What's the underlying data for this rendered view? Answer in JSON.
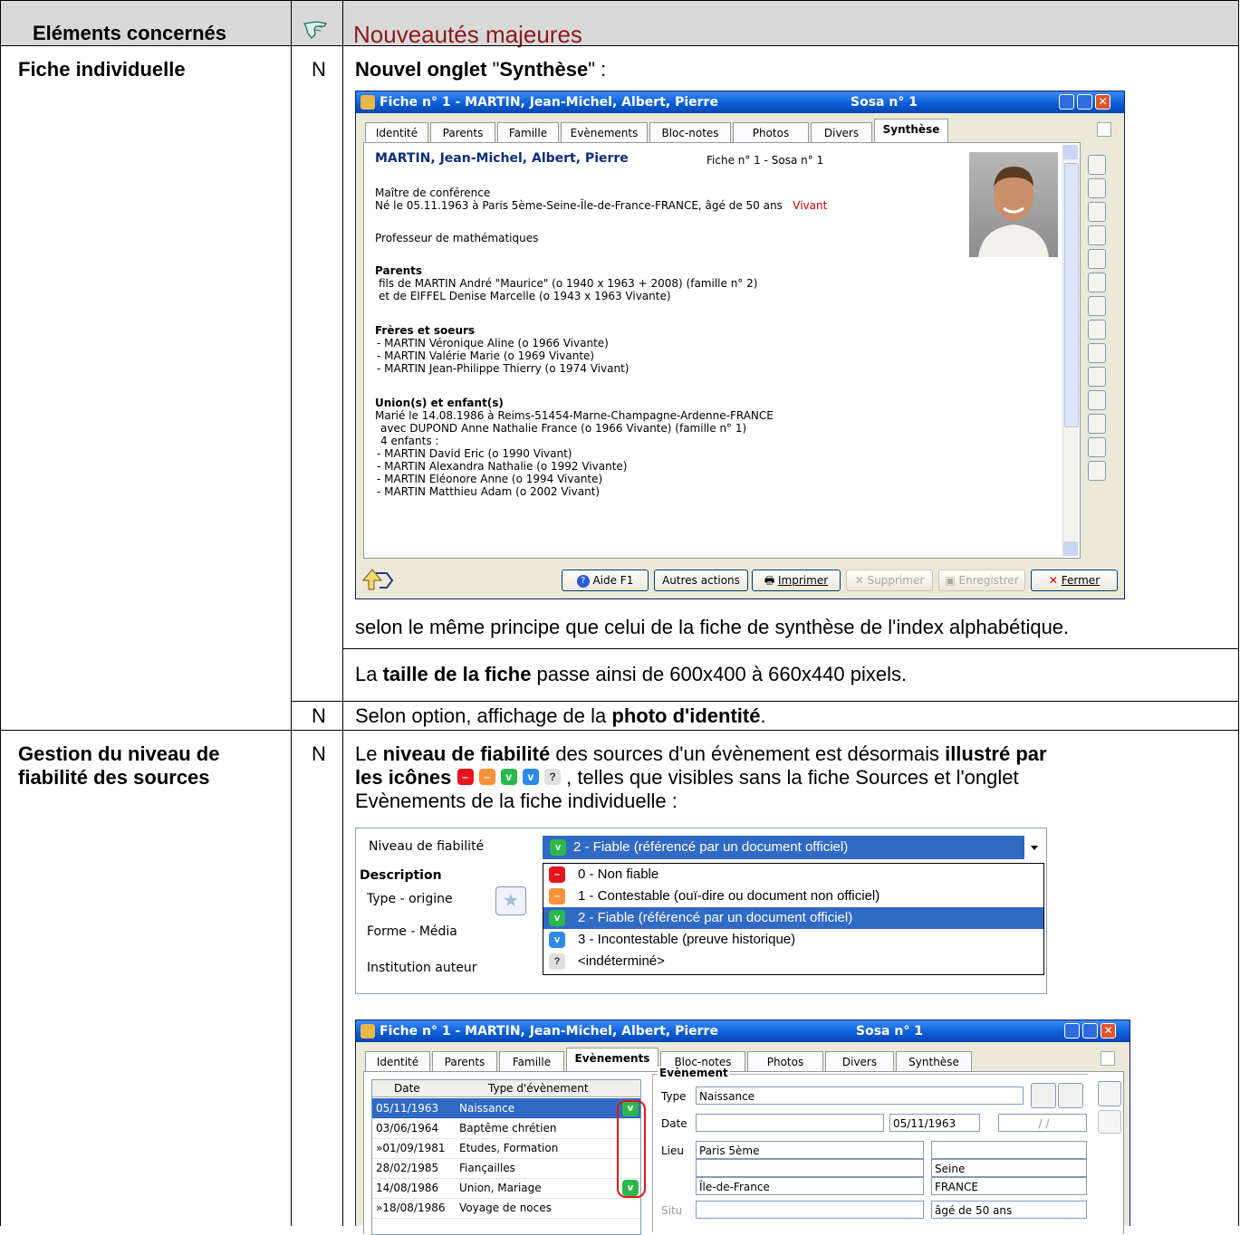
{
  "header": {
    "col1": "Eléments concernés",
    "col3": "Nouveautés majeures",
    "hand_icon": "pointing-hand-icon"
  },
  "row1": {
    "label": "Fiche individuelle",
    "flag": "N",
    "intro_bold1": "Nouvel onglet",
    "intro_mid": " \"",
    "intro_bold2": "Synthèse",
    "intro_end": "\" :",
    "after_text": "selon le même principe que celui de la fiche de synthèse de l'index alphabétique.",
    "size_pre": "La ",
    "size_bold": "taille de la fiche",
    "size_post": " passe ainsi de 600x400 à 660x440 pixels."
  },
  "row2": {
    "flag": "N",
    "pre": "Selon option, affichage de la ",
    "bold": "photo d'identité",
    "post": "."
  },
  "row3": {
    "label_line1": "Gestion du niveau de",
    "label_line2": "fiabilité des sources",
    "flag": "N",
    "l1_pre": "Le ",
    "l1_bold": "niveau de fiabilité",
    "l1_mid": " des sources d'un évènement est désormais ",
    "l1_bold2": "illustré par",
    "l2_bold": "les icônes",
    "l2_post": " , telles que visibles sans la fiche Sources et l'onglet",
    "l3": "Evènements de la fiche individuelle :"
  },
  "window1": {
    "title": "Fiche n° 1   -  MARTIN, Jean-Michel, Albert, Pierre",
    "sosa": "Sosa n° 1",
    "tabs": [
      "Identité",
      "Parents",
      "Famille",
      "Evènements",
      "Bloc-notes",
      "Photos",
      "Divers",
      "Synthèse"
    ],
    "name": "MARTIN, Jean-Michel, Albert, Pierre",
    "fiche_info": "Fiche n° 1  -  Sosa n° 1",
    "job": "Maître de conférence",
    "birth": "Né le 05.11.1963 à Paris 5ème-Seine-Île-de-France-FRANCE, âgé de 50 ans",
    "status": "Vivant",
    "job2": "Professeur de mathématiques",
    "parents_h": "Parents",
    "parent1": "fils de MARTIN André \"Maurice\" (o 1940  x 1963  + 2008)  (famille n° 2)",
    "parent2": "et de EIFFEL Denise Marcelle (o 1943  x 1963  Vivante)",
    "siblings_h": "Frères et soeurs",
    "sib1": "- MARTIN Véronique Aline (o 1966  Vivante)",
    "sib2": "- MARTIN Valérie Marie (o 1969  Vivante)",
    "sib3": "- MARTIN Jean-Philippe Thierry (o 1974  Vivant)",
    "union_h": "Union(s) et enfant(s)",
    "u1": "Marié le 14.08.1986  à Reims-51454-Marne-Champagne-Ardenne-FRANCE",
    "u2": "avec DUPOND Anne Nathalie France (o 1966  Vivante)  (famille n° 1)",
    "u3": "4 enfants :",
    "c1": "- MARTIN David Eric (o 1990  Vivant)",
    "c2": "- MARTIN Alexandra Nathalie (o 1992  Vivante)",
    "c3": "- MARTIN Eléonore Anne (o 1994  Vivante)",
    "c4": "- MARTIN Matthieu Adam (o 2002  Vivant)",
    "btn_help": "Aide  F1",
    "btn_other": "Autres actions",
    "btn_print": "Imprimer",
    "btn_delete": "Supprimer",
    "btn_save": "Enregistrer",
    "btn_close": "Fermer"
  },
  "fiab": {
    "label": "Niveau de fiabilité",
    "selected": "2 - Fiable (référencé par un document officiel)",
    "desc": "Description",
    "type": "Type - origine",
    "forme": "Forme - Média",
    "inst": "Institution auteur",
    "options": [
      {
        "icon": "–",
        "color": "#e8141c",
        "label": "0 - Non fiable"
      },
      {
        "icon": "–",
        "color": "#f7923a",
        "label": "1 - Contestable (ouï-dire ou document non officiel)"
      },
      {
        "icon": "v",
        "color": "#2bb84a",
        "label": "2 - Fiable (référencé par un document officiel)"
      },
      {
        "icon": "v",
        "color": "#2f8ae6",
        "label": "3 - Incontestable (preuve historique)"
      },
      {
        "icon": "?",
        "color": "#d8d8d8",
        "label": "<indéterminé>"
      }
    ]
  },
  "window2": {
    "title": "Fiche n° 1   -  MARTIN, Jean-Michel, Albert, Pierre",
    "sosa": "Sosa n° 1",
    "tabs": [
      "Identité",
      "Parents",
      "Famille",
      "Evènements",
      "Bloc-notes",
      "Photos",
      "Divers",
      "Synthèse"
    ],
    "col_date": "Date",
    "col_type": "Type d'évènement",
    "events": [
      {
        "date": "05/11/1963",
        "type": "Naissance",
        "ok": true
      },
      {
        "date": "03/06/1964",
        "type": "Baptême chrétien",
        "ok": false
      },
      {
        "date": "»01/09/1981",
        "type": "Etudes, Formation",
        "ok": false
      },
      {
        "date": "28/02/1985",
        "type": "Fiançailles",
        "ok": false
      },
      {
        "date": "14/08/1986",
        "type": "Union, Mariage",
        "ok": true
      },
      {
        "date": "»18/08/1986",
        "type": "Voyage de noces",
        "ok": false
      }
    ],
    "group": "Evènement",
    "type_lbl": "Type",
    "type_val": "Naissance",
    "date_lbl": "Date",
    "date_val": "05/11/1963",
    "date_val2": "/     /",
    "lieu_lbl": "Lieu",
    "lieu_val": "Paris 5ème",
    "dept": "Seine",
    "region": "Île-de-France",
    "country": "FRANCE",
    "situ_lbl": "Situ",
    "age": "âgé de 50 ans"
  }
}
